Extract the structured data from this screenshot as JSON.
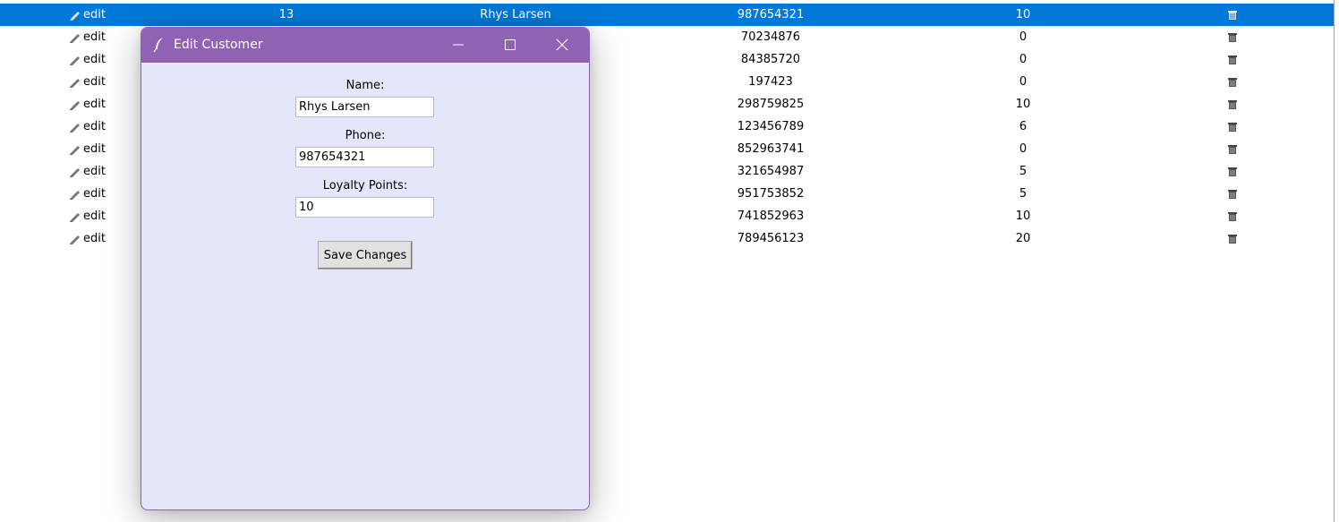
{
  "table": {
    "rows": [
      {
        "edit": "edit",
        "id": "13",
        "name": "Rhys Larsen",
        "phone": "987654321",
        "points": "10",
        "selected": true
      },
      {
        "edit": "edit",
        "phone": "70234876",
        "points": "0"
      },
      {
        "edit": "edit",
        "phone": "84385720",
        "points": "0"
      },
      {
        "edit": "edit",
        "phone": "197423",
        "points": "0"
      },
      {
        "edit": "edit",
        "phone": "298759825",
        "points": "10"
      },
      {
        "edit": "edit",
        "phone": "123456789",
        "points": "6"
      },
      {
        "edit": "edit",
        "phone": "852963741",
        "points": "0"
      },
      {
        "edit": "edit",
        "phone": "321654987",
        "points": "5"
      },
      {
        "edit": "edit",
        "phone": "951753852",
        "points": "5"
      },
      {
        "edit": "edit",
        "phone": "741852963",
        "points": "10"
      },
      {
        "edit": "edit",
        "phone": "789456123",
        "points": "20"
      }
    ],
    "edit_icon": "pencil-icon",
    "delete_icon": "trash-icon",
    "selection_color": "#0078d7"
  },
  "dialog": {
    "title": "Edit Customer",
    "title_icon": "feather-icon",
    "titlebar_color": "#9062b4",
    "background_color": "#e6e6fa",
    "buttons": {
      "minimize": "minimize-icon",
      "maximize": "maximize-icon",
      "close": "close-icon"
    },
    "fields": {
      "name_label": "Name:",
      "name_value": "Rhys Larsen",
      "phone_label": "Phone:",
      "phone_value": "987654321",
      "points_label": "Loyalty Points:",
      "points_value": "10"
    },
    "save_label": "Save Changes"
  }
}
